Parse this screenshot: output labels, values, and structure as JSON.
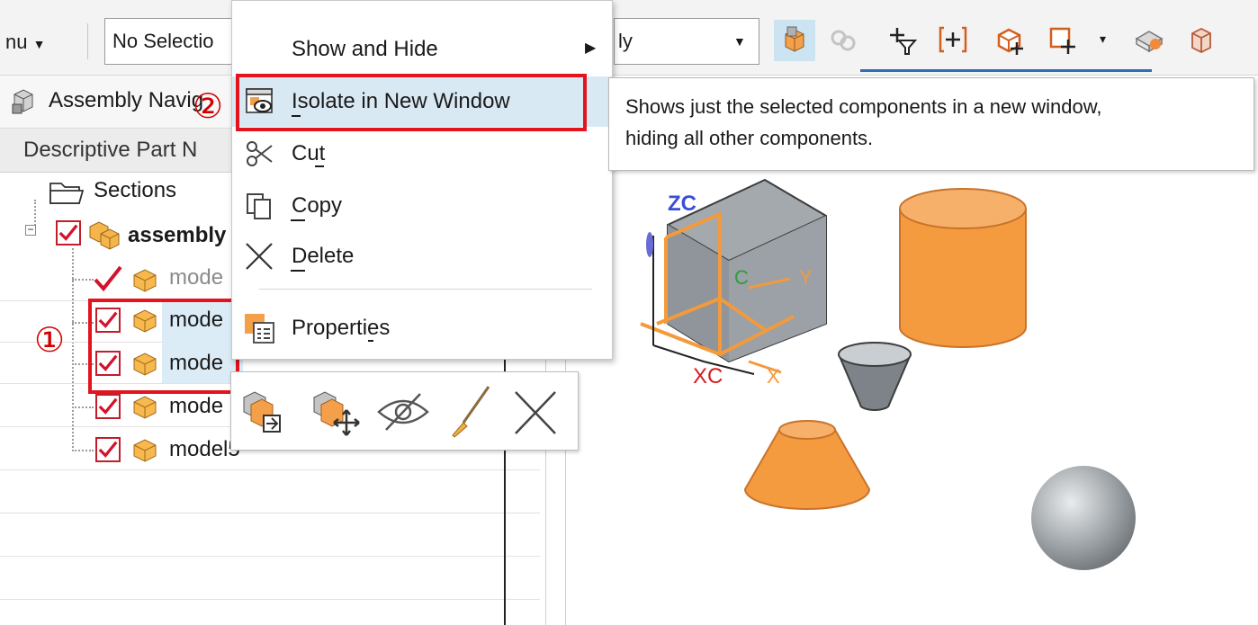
{
  "toolbar": {
    "menu_label": "nu",
    "selection_filter_value": "No Selectio",
    "scope_value": "ly"
  },
  "navigator": {
    "title": "Assembly Navig",
    "column_header": "Descriptive Part N",
    "sections_label": "Sections",
    "assembly_label": "assembly",
    "rows": [
      {
        "label": "mode",
        "checked": true,
        "boxed": false
      },
      {
        "label": "mode",
        "checked": true,
        "boxed": true
      },
      {
        "label": "mode",
        "checked": true,
        "boxed": true
      },
      {
        "label": "mode",
        "checked": true,
        "boxed": false
      },
      {
        "label": "model5",
        "checked": true,
        "boxed": false
      }
    ]
  },
  "context_menu": {
    "items": [
      {
        "id": "show-hide",
        "label": "Show and Hide",
        "has_submenu": true
      },
      {
        "id": "isolate",
        "label": "Isolate in New Window",
        "highlighted": true
      },
      {
        "id": "cut",
        "label": "Cut"
      },
      {
        "id": "copy",
        "label": "Copy"
      },
      {
        "id": "delete",
        "label": "Delete"
      },
      {
        "id": "properties",
        "label": "Properties"
      }
    ]
  },
  "tooltip": {
    "line1": "Shows just the selected components in a new window,",
    "line2": "hiding all other components."
  },
  "annotations": {
    "step1": "①",
    "step2": "②",
    "highlight_color": "#e3141e"
  },
  "viewport": {
    "axis_z": "ZC",
    "axis_x": "XC",
    "axis_y": "Y",
    "axis_x2": "X",
    "axis_c": "C",
    "model_color": "#f4a04b",
    "grey_color": "#9aa0a6"
  }
}
